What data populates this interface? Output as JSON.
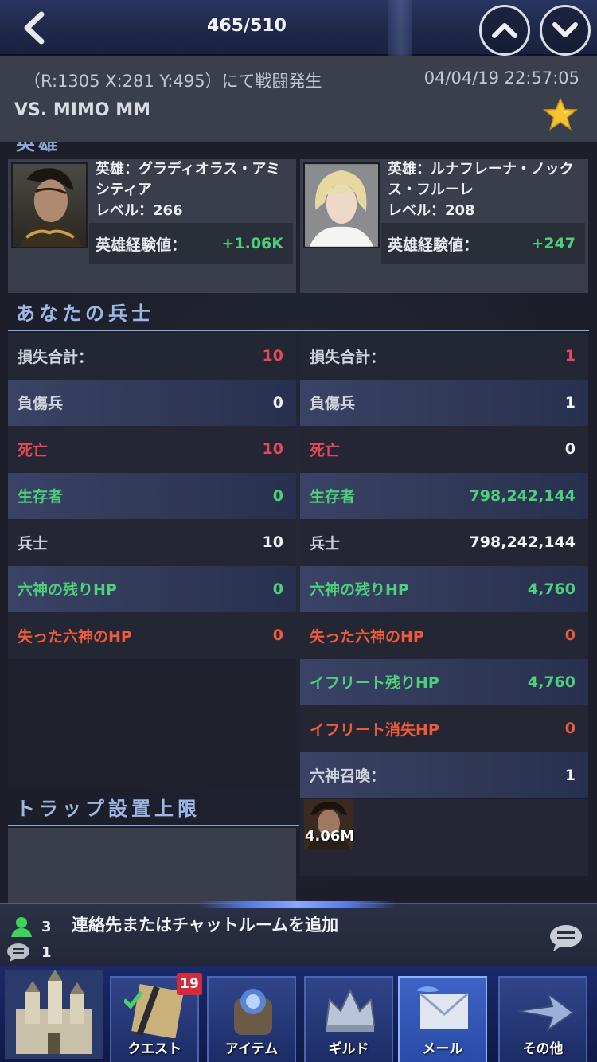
{
  "topbar": {
    "counter": "465/510",
    "back_icon": "chevron-left-icon",
    "prev_icon": "chevron-up-icon",
    "next_icon": "chevron-down-icon"
  },
  "report": {
    "location": "（R:1305 X:281 Y:495）にて戦闘発生",
    "timestamp": "04/04/19 22:57:05",
    "opponent": "VS. MIMO MM",
    "favorite_icon": "star-icon"
  },
  "heroes": {
    "cut_heading": "英雄",
    "left": {
      "name_line1": "英雄：グラディオラス・アミ",
      "name_line2": "シティア",
      "level": "レベル：266",
      "xp_label": "英雄経験値：",
      "xp_value": "+1.06K"
    },
    "right": {
      "name_line1": "英雄：ルナフレーナ・ノック",
      "name_line2": "ス・フルーレ",
      "level": "レベル：208",
      "xp_label": "英雄経験値：",
      "xp_value": "+247"
    }
  },
  "soldiers": {
    "title": "あなたの兵士",
    "left": [
      {
        "label": "損失合計：",
        "value": "10"
      },
      {
        "label": "負傷兵",
        "value": "0"
      },
      {
        "label": "死亡",
        "value": "10"
      },
      {
        "label": "生存者",
        "value": "0"
      },
      {
        "label": "兵士",
        "value": "10"
      },
      {
        "label": "六神の残りHP",
        "value": "0"
      },
      {
        "label": "失った六神のHP",
        "value": "0"
      }
    ],
    "right": [
      {
        "label": "損失合計：",
        "value": "1"
      },
      {
        "label": "負傷兵",
        "value": "1"
      },
      {
        "label": "死亡",
        "value": "0"
      },
      {
        "label": "生存者",
        "value": "798,242,144"
      },
      {
        "label": "兵士",
        "value": "798,242,144"
      },
      {
        "label": "六神の残りHP",
        "value": "4,760"
      },
      {
        "label": "失った六神のHP",
        "value": "0"
      },
      {
        "label": "イフリート残りHP",
        "value": "4,760"
      },
      {
        "label": "イフリート消失HP",
        "value": "0"
      },
      {
        "label": "六神召喚：",
        "value": "1"
      }
    ],
    "summon_value": "4.06M"
  },
  "trap": {
    "title": "トラップ設置上限"
  },
  "chat": {
    "contacts_count": "3",
    "messages_count": "1",
    "add_text": "連絡先またはチャットルームを追加"
  },
  "nav": {
    "quest_badge": "19",
    "tabs": [
      {
        "label": "クエスト"
      },
      {
        "label": "アイテム"
      },
      {
        "label": "ギルド"
      },
      {
        "label": "メール"
      },
      {
        "label": "その他"
      }
    ]
  },
  "colors": {
    "loss_red": "#e24a5a",
    "gain_green": "#4cd07a",
    "hp_lost_orange": "#ee5a3a",
    "section_blue": "#9fb7e6"
  }
}
